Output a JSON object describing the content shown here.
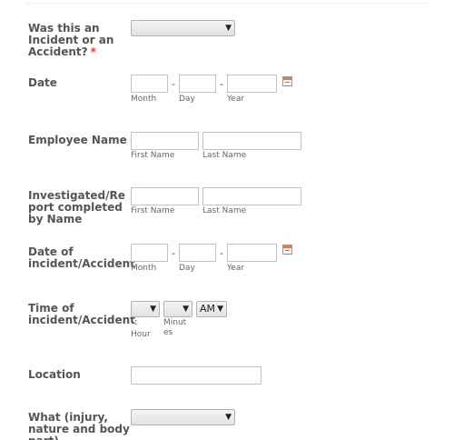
{
  "fields": {
    "incident_type": {
      "label": "Was this an Incident or an Accident?",
      "required_mark": "*",
      "selected": ""
    },
    "date": {
      "label": "Date",
      "month_label": "Month",
      "day_label": "Day",
      "year_label": "Year",
      "separator": "-"
    },
    "employee_name": {
      "label": "Employee Name",
      "first_label": "First Name",
      "last_label": "Last Name"
    },
    "investigated_by": {
      "label": "Investigated/Report completed by Name",
      "first_label": "First Name",
      "last_label": "Last Name"
    },
    "accident_date": {
      "label": "Date of incident/Accident",
      "month_label": "Month",
      "day_label": "Day",
      "year_label": "Year",
      "separator": "-"
    },
    "accident_time": {
      "label": "Time of incident/Accident",
      "colon": ":",
      "hour_label": "Hour",
      "minutes_label": "Minutes",
      "ampm_selected": "AM"
    },
    "location": {
      "label": "Location"
    },
    "what": {
      "label": "What (injury, nature and body part)",
      "selected": ""
    }
  },
  "icons": {
    "calendar": "calendar-icon",
    "dropdown": "chevron-down-icon"
  }
}
